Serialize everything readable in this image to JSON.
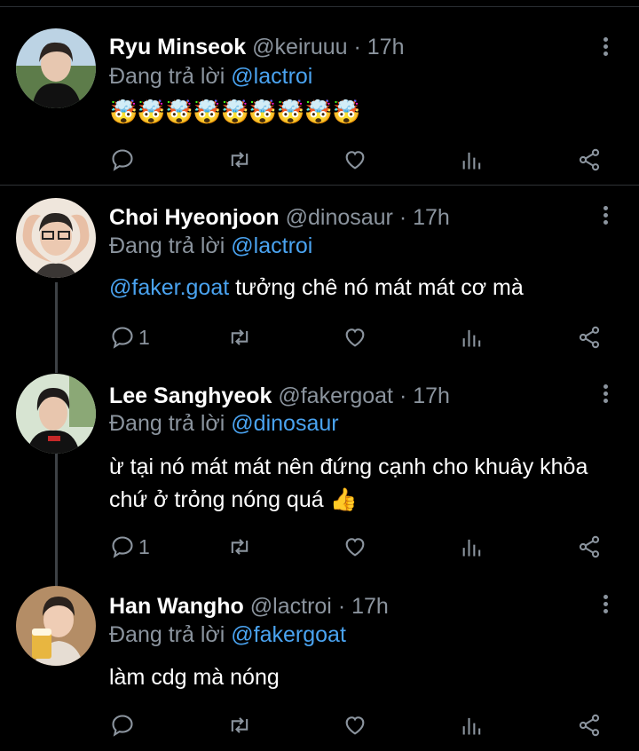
{
  "tweets": [
    {
      "name": "Ryu Minseok",
      "handle": "@keiruuu",
      "time": "· 17h",
      "reply_prefix": "Đang trả lời",
      "reply_to": "@lactroi",
      "emoji": "🤯🤯🤯🤯🤯🤯🤯🤯🤯",
      "reply_count": ""
    },
    {
      "name": "Choi Hyeonjoon",
      "handle": "@dinosaur",
      "time": "· 17h",
      "reply_prefix": "Đang trả lời",
      "reply_to": "@lactroi",
      "mention": "@faker.goat",
      "text": "tưởng chê nó mát mát cơ mà",
      "reply_count": "1"
    },
    {
      "name": "Lee Sanghyeok",
      "handle": "@fakergoat",
      "time": "· 17h",
      "reply_prefix": "Đang trả lời",
      "reply_to": "@dinosaur",
      "text_line1": "ừ tại nó mát mát nên đứng cạnh cho khuây khỏa",
      "text_line2": "chứ ở trỏng nóng quá 👍",
      "reply_count": "1"
    },
    {
      "name": "Han Wangho",
      "handle": "@lactroi",
      "time": "· 17h",
      "reply_prefix": "Đang trả lời",
      "reply_to": "@fakergoat",
      "text": "làm cdg mà nóng",
      "reply_count": ""
    }
  ],
  "icons": {
    "reply": "reply-icon",
    "retweet": "retweet-icon",
    "like": "heart-icon",
    "views": "views-icon",
    "share": "share-icon",
    "more": "more-icon"
  },
  "colors": {
    "background": "#000000",
    "mention": "#4aa3f0",
    "muted": "#8b949e"
  }
}
